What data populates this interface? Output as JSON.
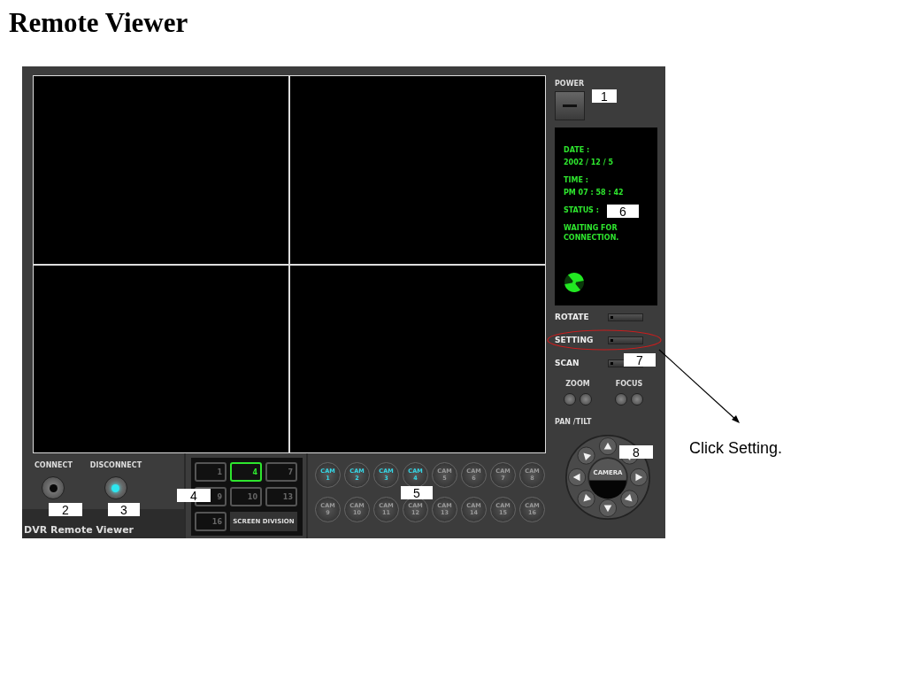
{
  "title": "Remote Viewer",
  "power": {
    "label": "POWER"
  },
  "status_display": {
    "date_label": "DATE :",
    "date": "2002 / 12 / 5",
    "time_label": "TIME :",
    "time": "PM 07 : 58 : 42",
    "status_label": "STATUS :",
    "status": "WAITING FOR CONNECTION."
  },
  "controls": [
    {
      "label": "ROTATE",
      "highlighted": false
    },
    {
      "label": "SETTING",
      "highlighted": true
    },
    {
      "label": "SCAN",
      "highlighted": false
    }
  ],
  "zoom_label": "ZOOM",
  "focus_label": "FOCUS",
  "pan_tilt_label": "PAN /TILT",
  "camera_label": "CAMERA",
  "connection": [
    {
      "label": "CONNECT",
      "lit": false
    },
    {
      "label": "DISCONNECT",
      "lit": true
    }
  ],
  "brand": "DVR Remote Viewer",
  "screen_division": {
    "label": "SCREEN DIVISION",
    "options": [
      {
        "label": "1",
        "selected": false
      },
      {
        "label": "4",
        "selected": true
      },
      {
        "label": "7",
        "selected": false
      },
      {
        "label": "9",
        "selected": false
      },
      {
        "label": "10",
        "selected": false
      },
      {
        "label": "13",
        "selected": false
      },
      {
        "label": "16",
        "selected": false
      }
    ]
  },
  "cameras": [
    {
      "name": "CAM",
      "number": "1",
      "active": true
    },
    {
      "name": "CAM",
      "number": "2",
      "active": true
    },
    {
      "name": "CAM",
      "number": "3",
      "active": true
    },
    {
      "name": "CAM",
      "number": "4",
      "active": true
    },
    {
      "name": "CAM",
      "number": "5",
      "active": false
    },
    {
      "name": "CAM",
      "number": "6",
      "active": false
    },
    {
      "name": "CAM",
      "number": "7",
      "active": false
    },
    {
      "name": "CAM",
      "number": "8",
      "active": false
    },
    {
      "name": "CAM",
      "number": "9",
      "active": false
    },
    {
      "name": "CAM",
      "number": "10",
      "active": false
    },
    {
      "name": "CAM",
      "number": "11",
      "active": false
    },
    {
      "name": "CAM",
      "number": "12",
      "active": false
    },
    {
      "name": "CAM",
      "number": "13",
      "active": false
    },
    {
      "name": "CAM",
      "number": "14",
      "active": false
    },
    {
      "name": "CAM",
      "number": "15",
      "active": false
    },
    {
      "name": "CAM",
      "number": "16",
      "active": false
    }
  ],
  "callouts": [
    "1",
    "2",
    "3",
    "4",
    "5",
    "6",
    "7",
    "8"
  ],
  "annotation": "Click Setting."
}
